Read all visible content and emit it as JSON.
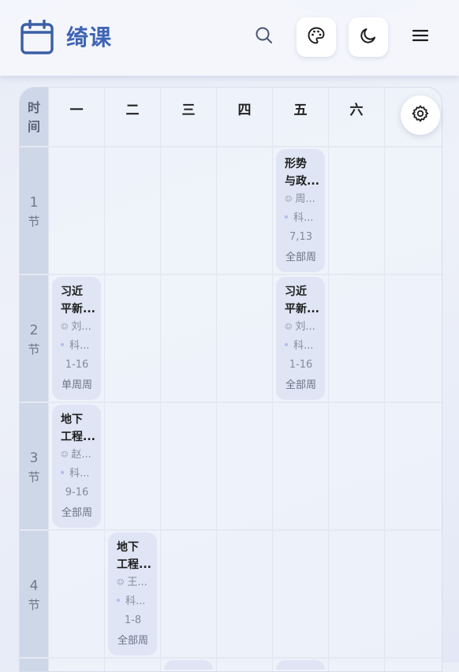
{
  "header": {
    "title": "绮课",
    "icons": {
      "logo": "calendar-icon",
      "search": "search-icon",
      "theme": "palette-icon",
      "darkmode": "moon-icon",
      "menu": "menu-icon",
      "settings": "gear-icon"
    }
  },
  "grid": {
    "time_header": "时间",
    "time_header_1": "时",
    "time_header_2": "间",
    "days": [
      "一",
      "二",
      "三",
      "四",
      "五",
      "六"
    ],
    "slots": [
      {
        "num": "1",
        "unit": "节"
      },
      {
        "num": "2",
        "unit": "节"
      },
      {
        "num": "3",
        "unit": "节"
      },
      {
        "num": "4",
        "unit": "节"
      }
    ]
  },
  "courses": [
    {
      "name1": "形势",
      "name2": "与政...",
      "teacher": "周...",
      "place": "科...",
      "weeks": "7,13",
      "week_type": "全部周"
    },
    {
      "name1": "习近",
      "name2": "平新...",
      "teacher": "刘...",
      "place": "科...",
      "weeks": "1-16",
      "week_type": "单周周"
    },
    {
      "name1": "习近",
      "name2": "平新...",
      "teacher": "刘...",
      "place": "科...",
      "weeks": "1-16",
      "week_type": "全部周"
    },
    {
      "name1": "地下",
      "name2": "工程...",
      "teacher": "赵...",
      "place": "科...",
      "weeks": "9-16",
      "week_type": "全部周"
    },
    {
      "name1": "地下",
      "name2": "工程...",
      "teacher": "王...",
      "place": "科...",
      "weeks": "1-8",
      "week_type": "全部周"
    }
  ],
  "colors": {
    "accent": "#3e63b3",
    "time_column": "#cdd7e7",
    "course_card": "#dee4f4"
  }
}
